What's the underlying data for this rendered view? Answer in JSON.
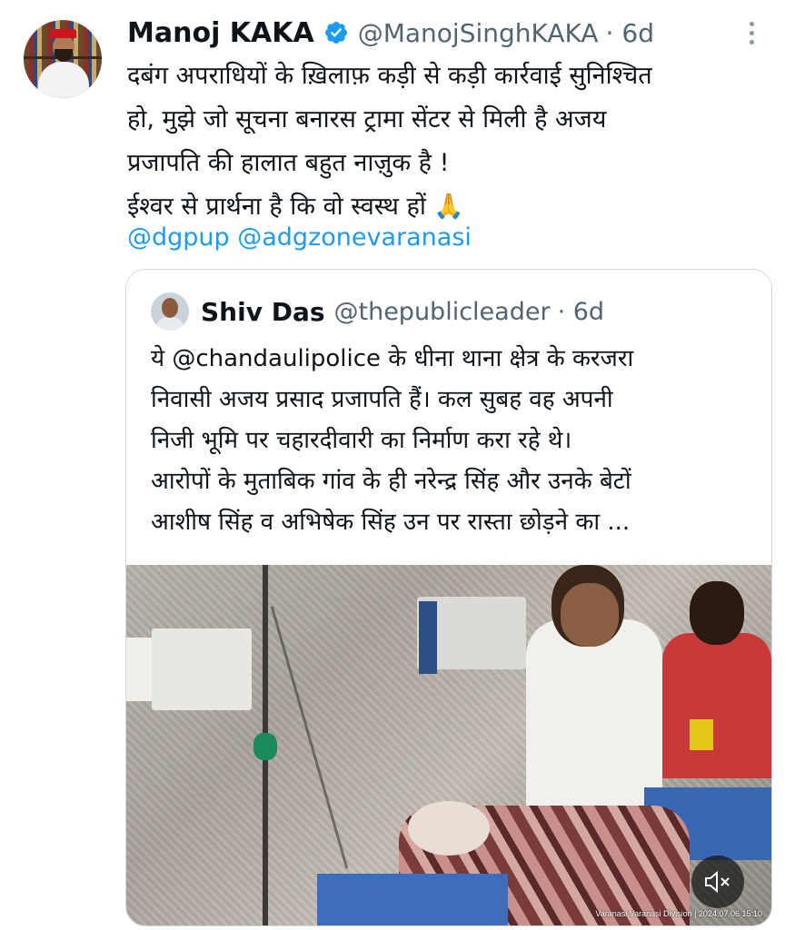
{
  "tweet": {
    "author_name": "Manoj KAKA",
    "handle": "@ManojSinghKAKA",
    "age": "· 6d",
    "text_lines": [
      "दबंग अपराधियों के ख़िलाफ़ कड़ी से कड़ी कार्रवाई सुनिश्चित",
      "हो, मुझे जो सूचना बनारस ट्रामा सेंटर से मिली है अजय",
      "प्रजापति की हालात बहुत नाज़ुक है !",
      "ईश्वर से प्रार्थना है कि वो स्वस्थ हों 🙏"
    ],
    "mentions": "@dgpup @adgzonevaranasi",
    "verified_color": "#1d9bf0"
  },
  "quote": {
    "author_name": "Shiv Das",
    "handle": "@thepublicleader",
    "age": "· 6d",
    "text_lines": [
      "ये @chandaulipolice के धीना थाना क्षेत्र के करजरा",
      "निवासी अजय प्रसाद प्रजापति हैं। कल सुबह वह अपनी",
      "निजी भूमि पर चहारदीवारी का निर्माण करा रहे थे।",
      "आरोपों के मुताबिक गांव के ही नरेन्द्र सिंह और उनके बेटों",
      "आशीष सिंह व अभिषेक सिंह उन पर रास्ता छोड़ने का ..."
    ],
    "media_watermark": "Varanasi,Varanasi Division | 2024.07.06 15:10",
    "mute_icon": "speaker-muted-icon"
  },
  "icons": {
    "more": "vertical-dots-icon",
    "verified": "verified-badge-icon"
  }
}
